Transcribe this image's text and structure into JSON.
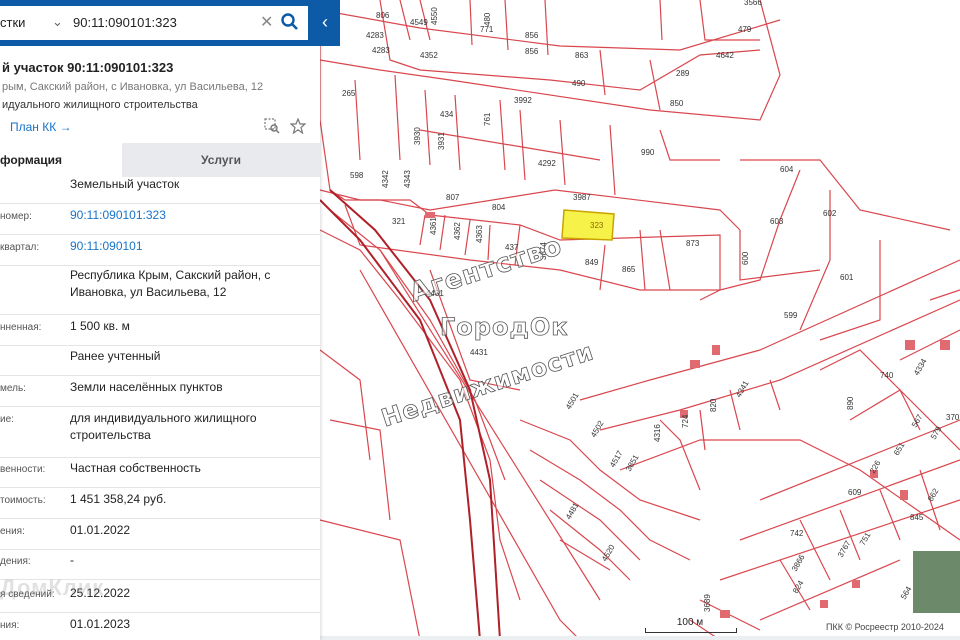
{
  "search": {
    "category_label": "стки",
    "query": "90:11:090101:323",
    "clear_glyph": "✕"
  },
  "parcel": {
    "title": "й участок 90:11:090101:323",
    "address": "рым, Сакский район, с Ивановка, ул Васильева, 12",
    "purpose": "идуального жилищного строительства",
    "plan_link": "План КК →"
  },
  "tabs": {
    "info": "формация",
    "services": "Услуги"
  },
  "rows": [
    {
      "label": "",
      "value": "Земельный участок",
      "link": false
    },
    {
      "label": "номер:",
      "value": "90:11:090101:323",
      "link": true
    },
    {
      "label": "квартал:",
      "value": "90:11:090101",
      "link": true
    },
    {
      "label": "",
      "value": "Республика Крым, Сакский район, с Ивановка, ул Васильева, 12",
      "link": false
    },
    {
      "label": "нненная:",
      "value": "1 500 кв. м",
      "link": false
    },
    {
      "label": "",
      "value": "Ранее учтенный",
      "link": false
    },
    {
      "label": "мель:",
      "value": "Земли населённых пунктов",
      "link": false
    },
    {
      "label": "ие:",
      "value": "для индивидуального жилищного строительства",
      "link": false
    },
    {
      "label": "венности:",
      "value": "Частная собственность",
      "link": false
    },
    {
      "label": "тоимость:",
      "value": "1 451 358,24 руб.",
      "link": false
    },
    {
      "label": "ения:",
      "value": "01.01.2022",
      "link": false
    },
    {
      "label": "дения:",
      "value": "-",
      "link": false
    },
    {
      "label": "я сведений:",
      "value": "25.12.2022",
      "link": false
    },
    {
      "label": "ния:",
      "value": "01.01.2023",
      "link": false
    }
  ],
  "watermark_panel": "ДомКлик",
  "map": {
    "selected_parcel": "323",
    "selected_color": "#f7f24a",
    "line_color": "#d9474e",
    "watermark_lines": [
      "Агентство",
      "ГородОк",
      "Недвижимости"
    ],
    "labels": [
      "806",
      "4549",
      "4550",
      "480",
      "3566",
      "4283",
      "4283",
      "771",
      "856",
      "479",
      "4352",
      "856",
      "863",
      "4642",
      "289",
      "265",
      "490",
      "3992",
      "850",
      "434",
      "761",
      "3930",
      "3931",
      "990",
      "4292",
      "598",
      "4342",
      "4343",
      "807",
      "804",
      "3987",
      "604",
      "321",
      "323",
      "603",
      "602",
      "4361",
      "4362",
      "4363",
      "437",
      "3874",
      "873",
      "849",
      "865",
      "600",
      "4431",
      "601",
      "599",
      "4431",
      "740",
      "4334",
      "4341",
      "820",
      "890",
      "724",
      "4316",
      "4501",
      "4502",
      "567",
      "579",
      "370",
      "4517",
      "3851",
      "651",
      "226",
      "609",
      "862",
      "4481",
      "845",
      "742",
      "751",
      "3767",
      "3866",
      "4520",
      "824",
      "3689",
      "564"
    ],
    "scale_label": "100 м",
    "copyright": "ПКК © Росреестр 2010-2024"
  }
}
